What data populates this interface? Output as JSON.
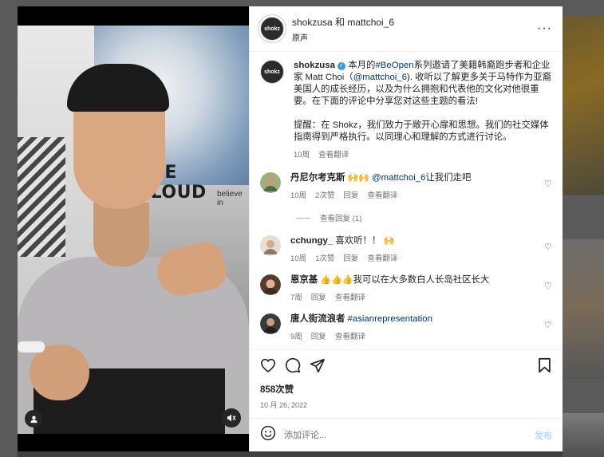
{
  "header": {
    "title": "shokzusa 和 mattchoi_6",
    "subtitle": "原声",
    "avatar_text": "shokz",
    "more_label": "···"
  },
  "video": {
    "sign_text": "THE CLOUD",
    "sign_subtext": "believe in"
  },
  "caption": {
    "username": "shokzusa",
    "text_part1": " 本月的",
    "hashtag": "#BeOpen",
    "text_part2": "系列邀请了美籍韩裔跑步者和企业家 Matt Choi（",
    "mention": "@mattchoi_6",
    "text_part3": "). 收听以了解更多关于马特作为亚裔美国人的成长经历，以及为什么拥抱和代表他的文化对他很重要。在下面的评论中分享您对这些主题的看法!",
    "text_part4": "提醒：在 Shokz，我们致力于敞开心扉和思想。我们的社交媒体指南得到严格执行。以同理心和理解的方式进行讨论。",
    "time": "10周",
    "translate": "查看翻译"
  },
  "comments": [
    {
      "username": "丹尼尔考克斯",
      "emojis": "🙌🙌",
      "mention": "@mattchoi_6",
      "text": "让我们走吧",
      "time": "10周",
      "likes": "2次赞",
      "reply": "回复",
      "translate": "查看翻译",
      "view_replies": "查看回复 (1)"
    },
    {
      "username": "cchungy_",
      "text": " 喜欢听！！",
      "emojis": "🙌",
      "time": "10周",
      "likes": "1次赞",
      "reply": "回复",
      "translate": "查看翻译"
    },
    {
      "username": "恩京基",
      "emojis": "👍👍👍",
      "text": "我可以在大多数白人长岛社区长大",
      "time": "7周",
      "reply": "回复",
      "translate": "查看翻译"
    },
    {
      "username": "唐人街流浪者",
      "hashtag": "#asianrepresentation",
      "time": "9周",
      "reply": "回复",
      "translate": "查看翻译"
    }
  ],
  "stats": {
    "likes": "858次赞",
    "date": "10 月 26, 2022"
  },
  "add_comment": {
    "placeholder": "添加评论...",
    "post_label": "发布"
  },
  "colors": {
    "link": "#00376b",
    "verified": "#3897f0",
    "post_button": "#b3dbff"
  }
}
